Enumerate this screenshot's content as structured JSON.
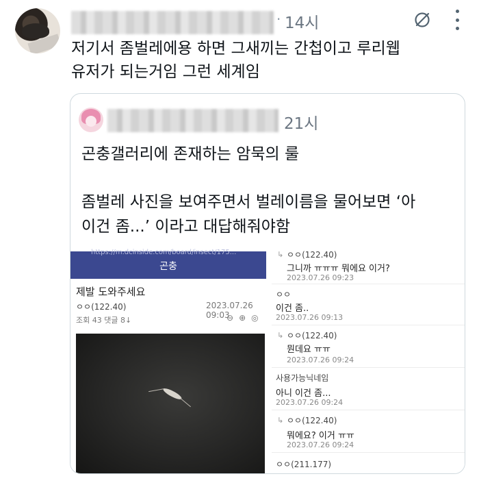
{
  "tweet": {
    "time": "14시",
    "text_line1": "저기서 좀벌레에용 하면 그새끼는 간첩이고 루리웹",
    "text_line2": "유저가 되는거임 그런 세계임"
  },
  "quote": {
    "time": "21시",
    "line1": "곤충갤러리에 존재하는 암묵의 룰",
    "line2": "좀벌레 사진을 보여주면서 벌레이름을 물어보면 ‘아",
    "line3": "이건 좀...’ 이라고 대답해줘야함"
  },
  "screenshot": {
    "url_fragment": "https://m.dcinside.com/board/insect/175...",
    "gallery_name": "곤충",
    "post_title": "제발 도와주세요",
    "post_user": "ㅇㅇ(122.40)",
    "post_date": "2023.07.26 09:03",
    "post_meta": "조회 43  댓글 8↓",
    "comments": [
      {
        "user": "ㅇㅇ(122.40)",
        "text": "그니까 ㅠㅠㅠ 뭐에요 이거?",
        "date": "2023.07.26 09:23",
        "reply": true
      },
      {
        "user": "ㅇㅇ",
        "text": "이건 좀..",
        "date": "2023.07.26 09:13",
        "reply": false
      },
      {
        "user": "ㅇㅇ(122.40)",
        "text": "뭔데요 ㅠㅠ",
        "date": "2023.07.26 09:24",
        "reply": true
      },
      {
        "user": "사용가능닉네임",
        "text": "아니 이건 좀...",
        "date": "2023.07.26 09:24",
        "reply": false
      },
      {
        "user": "ㅇㅇ(122.40)",
        "text": "뭐에요? 이거 ㅠㅠ",
        "date": "2023.07.26 09:24",
        "reply": true
      },
      {
        "user": "ㅇㅇ(211.177)",
        "text": "",
        "date": "",
        "reply": false
      }
    ]
  },
  "icons": {
    "grok": "grok-icon",
    "more": "more-icon"
  },
  "colors": {
    "gallery_bar": "#3b4890",
    "border": "#cfd9de",
    "secondary_text": "#6b7682"
  }
}
